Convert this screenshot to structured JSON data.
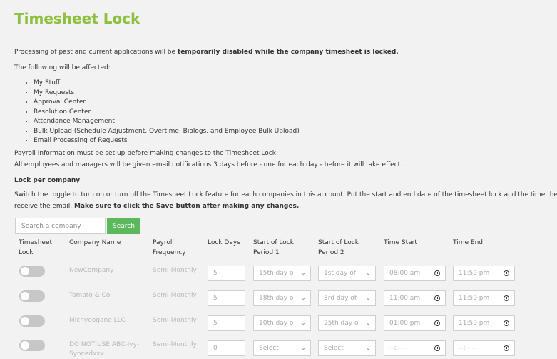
{
  "page": {
    "title": "Timesheet Lock",
    "intro_prefix": "Processing of past and current applications will be ",
    "intro_bold": "temporarily disabled while the company timesheet is locked.",
    "affected_heading": "The following will be affected:",
    "affected_items": [
      "My Stuff",
      "My Requests",
      "Approval Center",
      "Resolution Center",
      "Attendance Management",
      "Bulk Upload (Schedule Adjustment, Overtime, Biologs, and Employee Bulk Upload)",
      "Email Processing of Requests"
    ],
    "payroll_note": "Payroll Information must be set up before making changes to the Timesheet Lock.",
    "email_note": "All employees and managers will be given email notifications 3 days before - one for each day - before it will take effect.",
    "lock_heading": "Lock per company",
    "switch_line1": "Switch the toggle to turn on or turn off the Timesheet Lock feature for each companies in this account. Put the start and end date of the timesheet lock and the time they will",
    "switch_line2_prefix": "receive the email. ",
    "switch_line2_bold": "Make sure to click the Save button after making any changes."
  },
  "search": {
    "placeholder": "Search a company",
    "button_label": "Search"
  },
  "table": {
    "headers": {
      "lock": [
        "Timesheet",
        "Lock"
      ],
      "company": "Company Name",
      "payroll": [
        "Payroll",
        "Frequency"
      ],
      "lock_days": "Lock Days",
      "start1": [
        "Start of Lock",
        "Period 1"
      ],
      "start2": [
        "Start of Lock",
        "Period 2"
      ],
      "time_start": "Time Start",
      "time_end": "Time End"
    },
    "rows": [
      {
        "company": [
          "NewCompany"
        ],
        "payroll": "Semi-Monthly",
        "lock_days": "5",
        "period1": "15th day o",
        "period2": "1st day of",
        "time_start": "08:00 am",
        "time_end": "11:59 pm"
      },
      {
        "company": [
          "Tomato & Co."
        ],
        "payroll": "Semi-Monthly",
        "lock_days": "5",
        "period1": "18th day o",
        "period2": "3rd day of",
        "time_start": "11:00 am",
        "time_end": "11:59 pm"
      },
      {
        "company": [
          "Michyeogane LLC"
        ],
        "payroll": "Semi-Monthly",
        "lock_days": "5",
        "period1": "10th day o",
        "period2": "25th day o",
        "time_start": "01:00 pm",
        "time_end": "11:59 pm"
      },
      {
        "company": [
          "DO NOT USE ABC-Ivy-",
          "Syncedxxx"
        ],
        "payroll": "Semi-Monthly",
        "lock_days": "0",
        "period1": "Select",
        "period2": "Select",
        "time_start": "--:-- --",
        "time_end": "--:-- --"
      }
    ]
  },
  "icons": {
    "chevron": "chevron-down-icon",
    "clock": "clock-icon"
  },
  "colors": {
    "title": "#8ec03f",
    "search_button": "#5cb85c",
    "toggle_off": "#c7c7c7"
  }
}
